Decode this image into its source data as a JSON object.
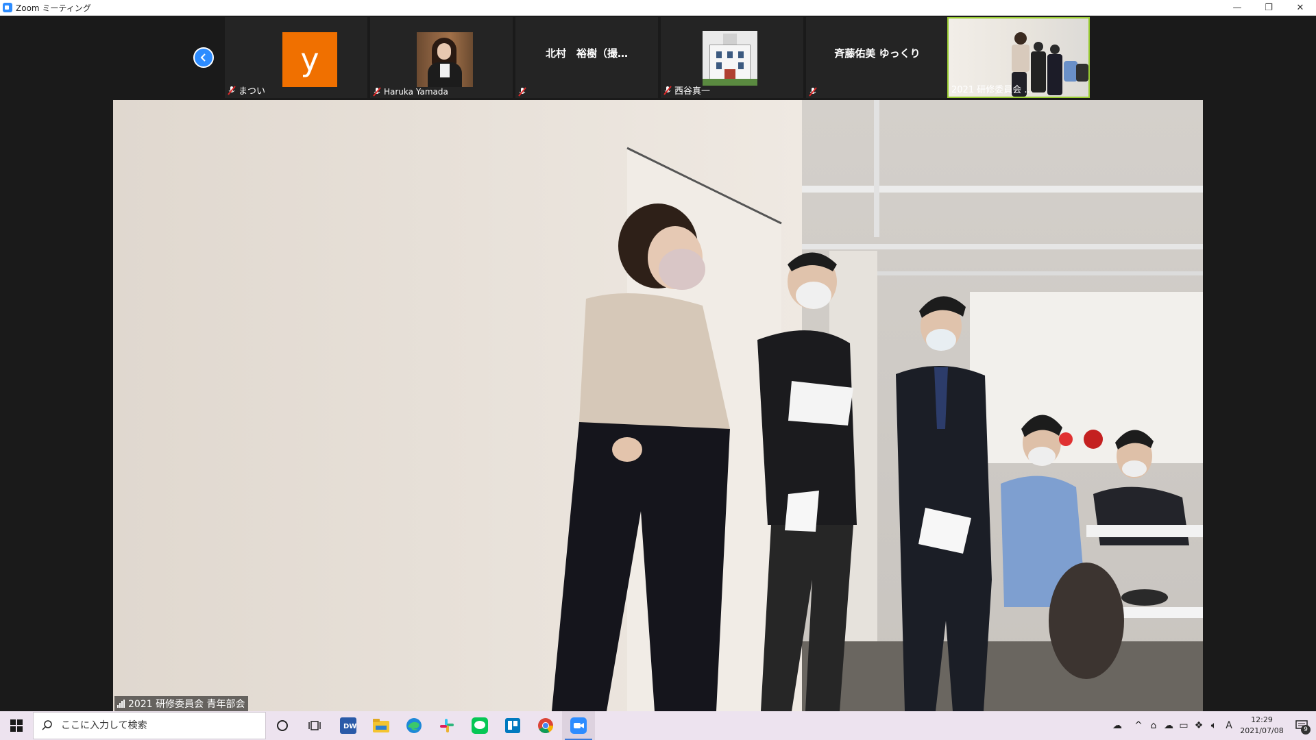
{
  "window": {
    "title": "Zoom ミーティング",
    "minimize": "—",
    "restore": "❐",
    "close": "✕"
  },
  "gallery": {
    "participants": [
      {
        "name": "まつい",
        "avatar_letter": "y",
        "avatar_color": "#f07000",
        "muted": true
      },
      {
        "name": "Haruka Yamada",
        "muted": true
      },
      {
        "name": "",
        "display_name": "北村　裕樹（撮…",
        "muted": true
      },
      {
        "name": "西谷真一",
        "muted": true
      },
      {
        "name": "",
        "display_name": "斉藤佑美 ゆっくり",
        "muted": true
      },
      {
        "name": "2021 研修委員会 ...",
        "muted": false,
        "active_speaker": true
      }
    ]
  },
  "main_video": {
    "label": "2021 研修委員会 青年部会"
  },
  "taskbar": {
    "search_placeholder": "ここに入力して検索",
    "pinned": [
      "cortana-icon",
      "task-view-icon",
      "dreamweaver-icon",
      "file-explorer-icon",
      "edge-icon",
      "slack-icon",
      "line-icon",
      "trello-icon",
      "chrome-icon",
      "zoom-icon"
    ],
    "tray": {
      "ime": "A",
      "time": "12:29",
      "date": "2021/07/08",
      "notification_count": "9"
    }
  },
  "colors": {
    "accent": "#2d8cff",
    "active_border": "#9acd32",
    "taskbar_bg": "#ede3ef"
  }
}
